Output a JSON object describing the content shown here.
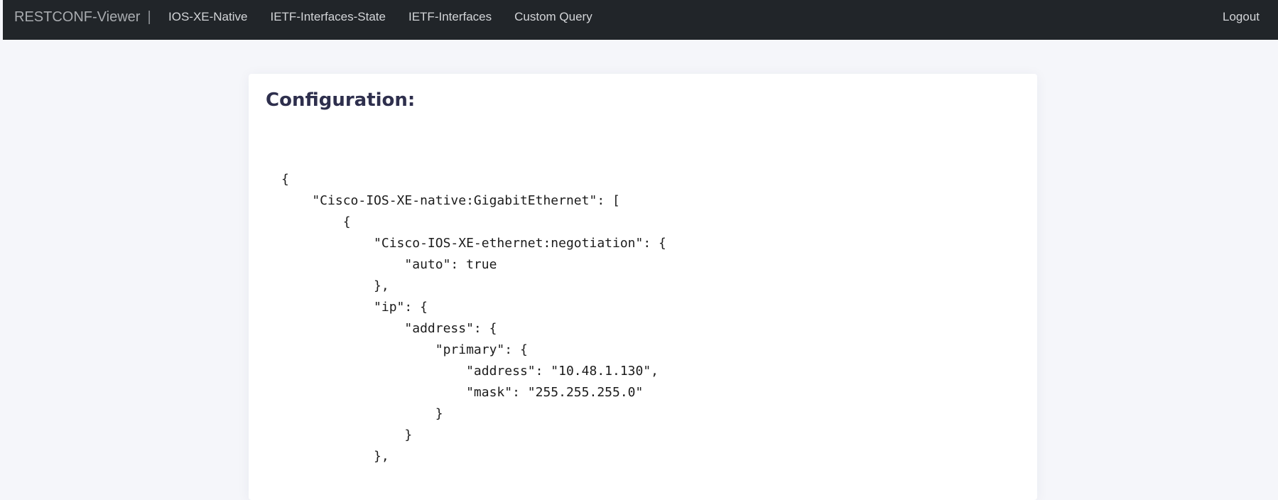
{
  "navbar": {
    "brand": "RESTCONF-Viewer",
    "separator": "|",
    "links": [
      {
        "label": "IOS-XE-Native"
      },
      {
        "label": "IETF-Interfaces-State"
      },
      {
        "label": "IETF-Interfaces"
      },
      {
        "label": "Custom Query"
      }
    ],
    "logout_label": "Logout"
  },
  "main": {
    "title": "Configuration:",
    "code": "{\n    \"Cisco-IOS-XE-native:GigabitEthernet\": [\n        {\n            \"Cisco-IOS-XE-ethernet:negotiation\": {\n                \"auto\": true\n            },\n            \"ip\": {\n                \"address\": {\n                    \"primary\": {\n                        \"address\": \"10.48.1.130\",\n                        \"mask\": \"255.255.255.0\"\n                    }\n                }\n            },"
  },
  "colors": {
    "navbar_bg": "#212529",
    "page_bg": "#f5f6fa",
    "title": "#2e2f4d"
  }
}
